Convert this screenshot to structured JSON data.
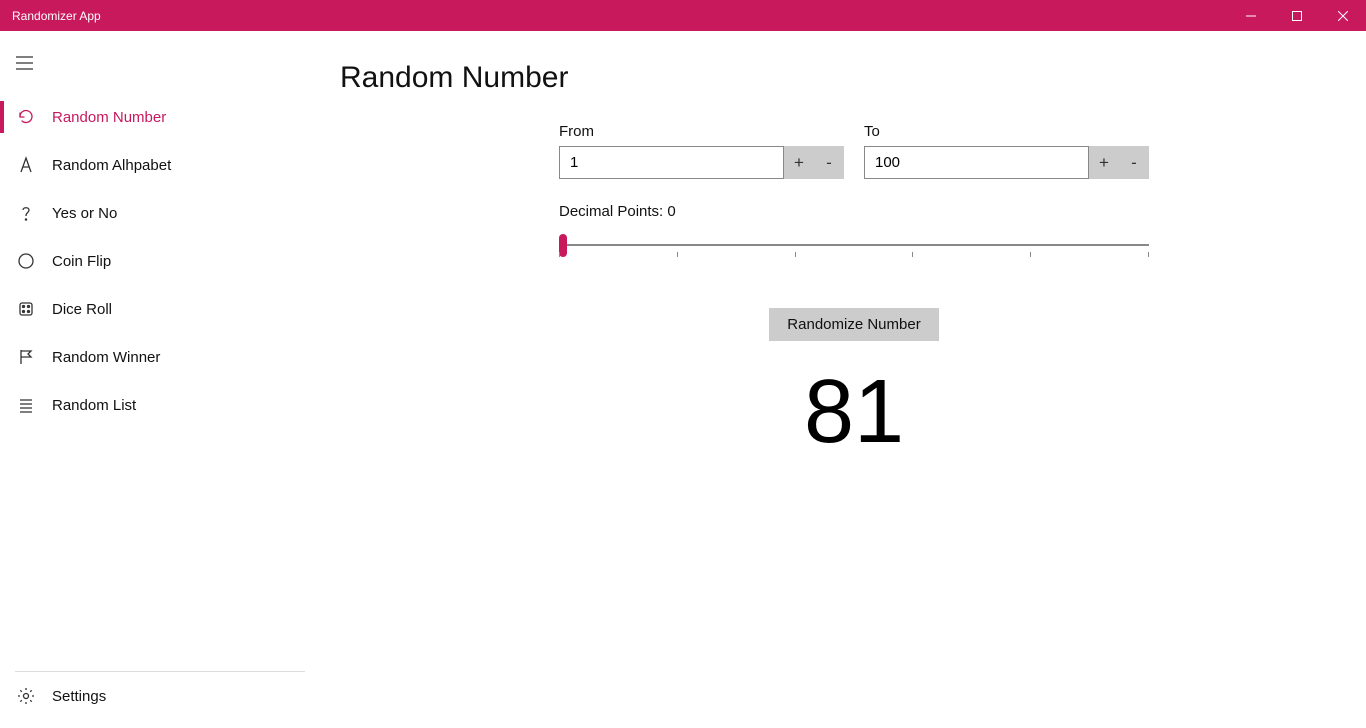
{
  "window": {
    "title": "Randomizer App"
  },
  "sidebar": {
    "items": [
      {
        "label": "Random Number",
        "icon": "refresh-icon",
        "active": true
      },
      {
        "label": "Random Alhpabet",
        "icon": "letter-a-icon",
        "active": false
      },
      {
        "label": "Yes or No",
        "icon": "question-icon",
        "active": false
      },
      {
        "label": "Coin Flip",
        "icon": "circle-icon",
        "active": false
      },
      {
        "label": "Dice Roll",
        "icon": "dice-icon",
        "active": false
      },
      {
        "label": "Random Winner",
        "icon": "flag-icon",
        "active": false
      },
      {
        "label": "Random List",
        "icon": "list-icon",
        "active": false
      }
    ],
    "settings_label": "Settings"
  },
  "main": {
    "page_title": "Random Number",
    "from_label": "From",
    "to_label": "To",
    "from_value": "1",
    "to_value": "100",
    "plus": "+",
    "minus": "-",
    "decimal_label": "Decimal Points: 0",
    "randomize_label": "Randomize Number",
    "result": "81"
  },
  "colors": {
    "accent": "#c7195c"
  }
}
